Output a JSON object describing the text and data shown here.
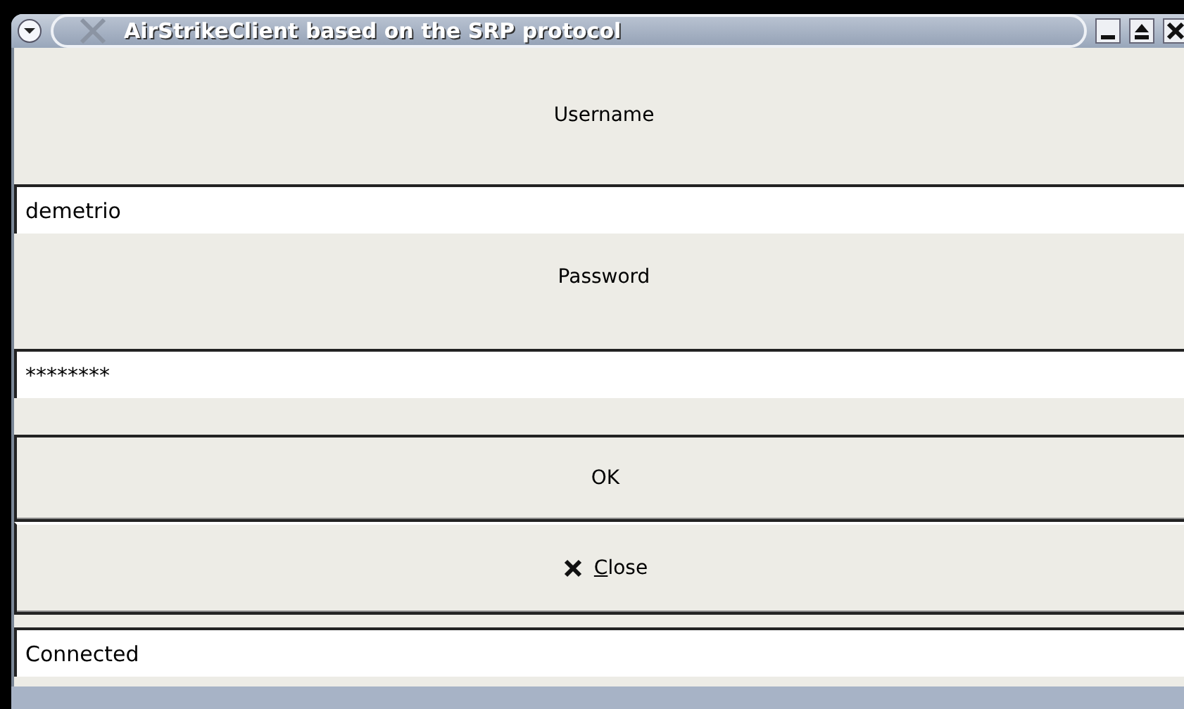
{
  "window": {
    "title": "AirStrikeClient based on the SRP protocol"
  },
  "fields": [
    {
      "label": "Username",
      "value": "demetrio"
    },
    {
      "label": "Password",
      "value": "********"
    }
  ],
  "buttons": [
    {
      "label": "OK",
      "kind": "plain"
    },
    {
      "label": "Close",
      "kind": "close",
      "mnemonic_underlined": true
    }
  ],
  "status": {
    "value": "Connected"
  }
}
